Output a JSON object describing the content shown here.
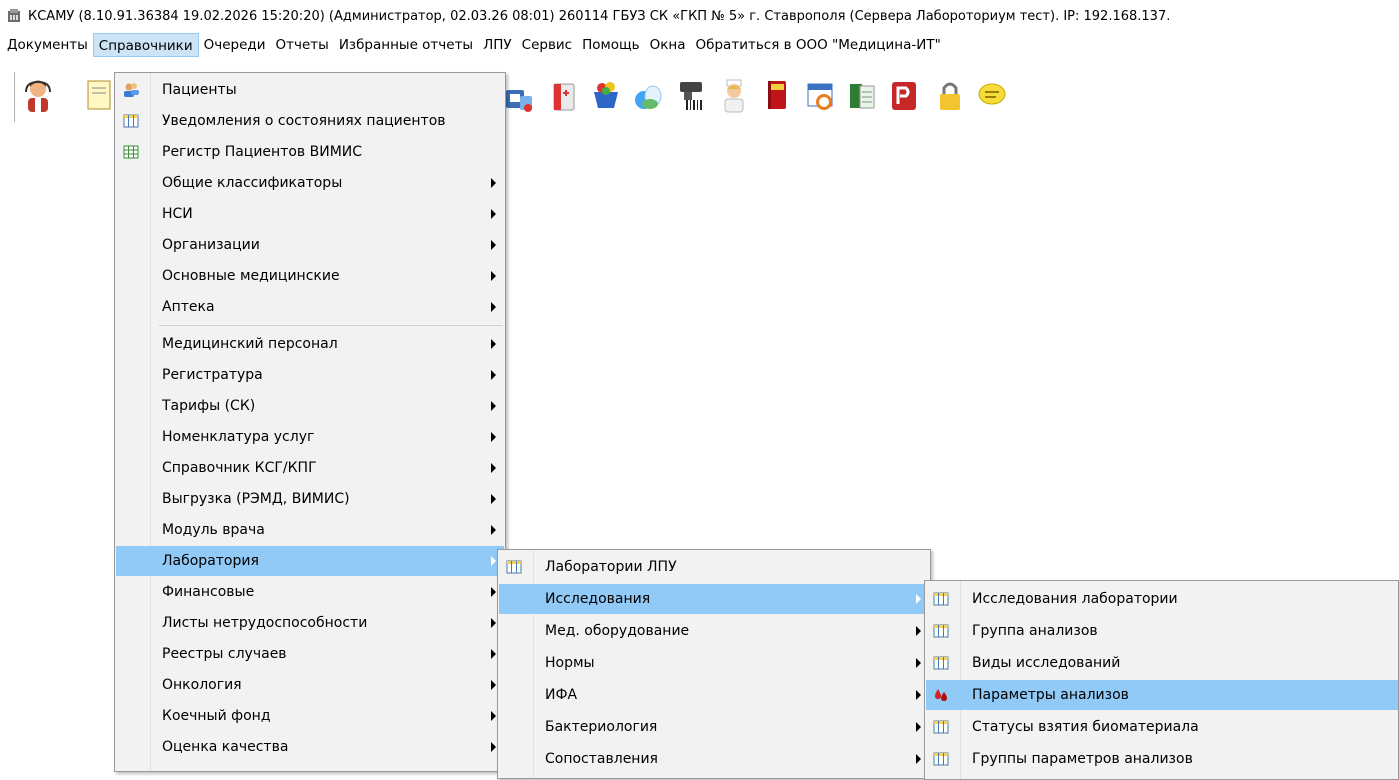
{
  "window": {
    "title": "КСАМУ (8.10.91.36384 19.02.2026 15:20:20) (Администратор, 02.03.26 08:01)  260114 ГБУЗ СК «ГКП № 5» г. Ставрополя (Сервера Лабороториум тест). IP: 192.168.137."
  },
  "menubar": {
    "items": [
      {
        "label": "Документы"
      },
      {
        "label": "Справочники"
      },
      {
        "label": "Очереди"
      },
      {
        "label": "Отчеты"
      },
      {
        "label": "Избранные отчеты"
      },
      {
        "label": "ЛПУ"
      },
      {
        "label": "Сервис"
      },
      {
        "label": "Помощь"
      },
      {
        "label": "Окна"
      },
      {
        "label": "Обратиться в ООО \"Медицина-ИТ\""
      }
    ]
  },
  "toolbar": {
    "icons": [
      "doctor-icon",
      "notepad-icon",
      "medicines-icon",
      "first-aid-icon",
      "basket-icon",
      "pills-icon",
      "barcode-scanner-icon",
      "nurse-icon",
      "red-book-icon",
      "calendar-clock-icon",
      "ledger-icon",
      "pdf-icon",
      "lock-icon",
      "chat-icon"
    ]
  },
  "menu_spravochniki": {
    "items": [
      {
        "label": "Пациенты",
        "icon": "patients-icon",
        "submenu": false
      },
      {
        "label": "Уведомления о состояниях пациентов",
        "icon": "grid-icon",
        "submenu": false
      },
      {
        "label": "Регистр Пациентов ВИМИС",
        "icon": "green-grid-icon",
        "submenu": false
      },
      {
        "label": "Общие классификаторы",
        "icon": "",
        "submenu": true
      },
      {
        "label": "НСИ",
        "icon": "",
        "submenu": true
      },
      {
        "label": "Организации",
        "icon": "",
        "submenu": true
      },
      {
        "label": "Основные медицинские",
        "icon": "",
        "submenu": true
      },
      {
        "label": "Аптека",
        "icon": "",
        "submenu": true
      },
      {
        "label": "Медицинский персонал",
        "icon": "",
        "submenu": true
      },
      {
        "label": "Регистратура",
        "icon": "",
        "submenu": true
      },
      {
        "label": "Тарифы (СК)",
        "icon": "",
        "submenu": true
      },
      {
        "label": "Номенклатура услуг",
        "icon": "",
        "submenu": true
      },
      {
        "label": "Справочник КСГ/КПГ",
        "icon": "",
        "submenu": true
      },
      {
        "label": "Выгрузка (РЭМД, ВИМИС)",
        "icon": "",
        "submenu": true
      },
      {
        "label": "Модуль врача",
        "icon": "",
        "submenu": true
      },
      {
        "label": "Лаборатория",
        "icon": "",
        "submenu": true,
        "highlighted": true
      },
      {
        "label": "Финансовые",
        "icon": "",
        "submenu": true
      },
      {
        "label": "Листы нетрудоспособности",
        "icon": "",
        "submenu": true
      },
      {
        "label": "Реестры случаев",
        "icon": "",
        "submenu": true
      },
      {
        "label": "Онкология",
        "icon": "",
        "submenu": true
      },
      {
        "label": "Коечный фонд",
        "icon": "",
        "submenu": true
      },
      {
        "label": "Оценка качества",
        "icon": "",
        "submenu": true
      }
    ]
  },
  "menu_laboratoriya": {
    "items": [
      {
        "label": "Лаборатории ЛПУ",
        "icon": "grid-icon",
        "submenu": false
      },
      {
        "label": "Исследования",
        "icon": "",
        "submenu": true,
        "highlighted": true
      },
      {
        "label": "Мед. оборудование",
        "icon": "",
        "submenu": true
      },
      {
        "label": "Нормы",
        "icon": "",
        "submenu": true
      },
      {
        "label": "ИФА",
        "icon": "",
        "submenu": true
      },
      {
        "label": "Бактериология",
        "icon": "",
        "submenu": true
      },
      {
        "label": "Сопоставления",
        "icon": "",
        "submenu": true
      }
    ]
  },
  "menu_issledovaniya": {
    "items": [
      {
        "label": "Исследования лаборатории",
        "icon": "grid-icon"
      },
      {
        "label": "Группа анализов",
        "icon": "grid-icon"
      },
      {
        "label": "Виды исследований",
        "icon": "grid-icon"
      },
      {
        "label": "Параметры анализов",
        "icon": "blood-drops-icon",
        "highlighted": true
      },
      {
        "label": "Статусы взятия биоматериала",
        "icon": "grid-icon"
      },
      {
        "label": "Группы параметров анализов",
        "icon": "grid-icon"
      }
    ]
  },
  "colors": {
    "menu_bg": "#f2f2f2",
    "highlight": "#91c9f7",
    "menubar_active": "#cce4f7"
  }
}
